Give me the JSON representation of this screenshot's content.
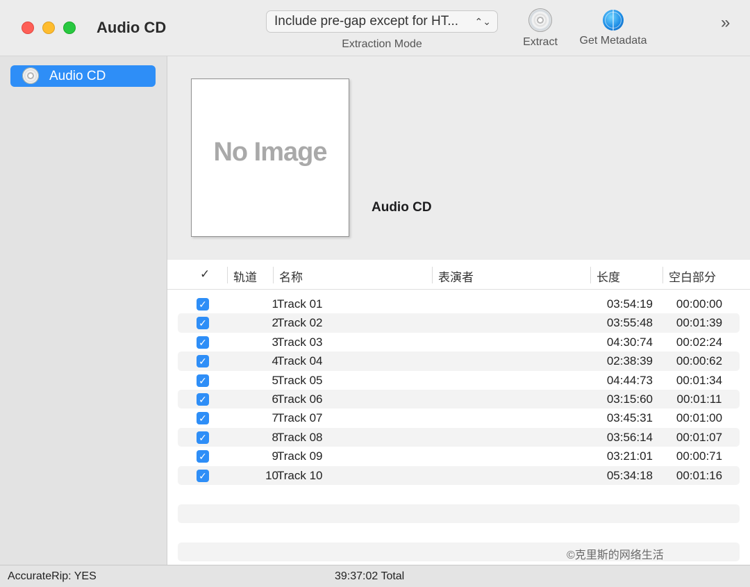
{
  "window": {
    "title": "Audio CD"
  },
  "toolbar": {
    "extraction_mode_value": "Include pre-gap except for HT...",
    "extraction_mode_label": "Extraction Mode",
    "extract_label": "Extract",
    "get_metadata_label": "Get Metadata",
    "overflow_glyph": "»"
  },
  "sidebar": {
    "items": [
      {
        "label": "Audio CD",
        "selected": true
      }
    ]
  },
  "album": {
    "artwork_placeholder": "No Image",
    "title": "Audio CD"
  },
  "table": {
    "columns": {
      "check": "✓",
      "track": "轨道",
      "name": "名称",
      "artist": "表演者",
      "length": "长度",
      "pregap": "空白部分"
    },
    "rows": [
      {
        "checked": true,
        "track": "1",
        "name": "Track 01",
        "artist": "",
        "length": "03:54:19",
        "pregap": "00:00:00"
      },
      {
        "checked": true,
        "track": "2",
        "name": "Track 02",
        "artist": "",
        "length": "03:55:48",
        "pregap": "00:01:39"
      },
      {
        "checked": true,
        "track": "3",
        "name": "Track 03",
        "artist": "",
        "length": "04:30:74",
        "pregap": "00:02:24"
      },
      {
        "checked": true,
        "track": "4",
        "name": "Track 04",
        "artist": "",
        "length": "02:38:39",
        "pregap": "00:00:62"
      },
      {
        "checked": true,
        "track": "5",
        "name": "Track 05",
        "artist": "",
        "length": "04:44:73",
        "pregap": "00:01:34"
      },
      {
        "checked": true,
        "track": "6",
        "name": "Track 06",
        "artist": "",
        "length": "03:15:60",
        "pregap": "00:01:11"
      },
      {
        "checked": true,
        "track": "7",
        "name": "Track 07",
        "artist": "",
        "length": "03:45:31",
        "pregap": "00:01:00"
      },
      {
        "checked": true,
        "track": "8",
        "name": "Track 08",
        "artist": "",
        "length": "03:56:14",
        "pregap": "00:01:07"
      },
      {
        "checked": true,
        "track": "9",
        "name": "Track 09",
        "artist": "",
        "length": "03:21:01",
        "pregap": "00:00:71"
      },
      {
        "checked": true,
        "track": "10",
        "name": "Track 10",
        "artist": "",
        "length": "05:34:18",
        "pregap": "00:01:16"
      }
    ]
  },
  "watermark": "©克里斯的网络生活",
  "statusbar": {
    "accuraterip": "AccurateRip: YES",
    "total": "39:37:02 Total"
  },
  "colors": {
    "accent": "#2e8ef7",
    "close": "#fe5f57",
    "minimize": "#febc2e",
    "maximize": "#28c840"
  }
}
